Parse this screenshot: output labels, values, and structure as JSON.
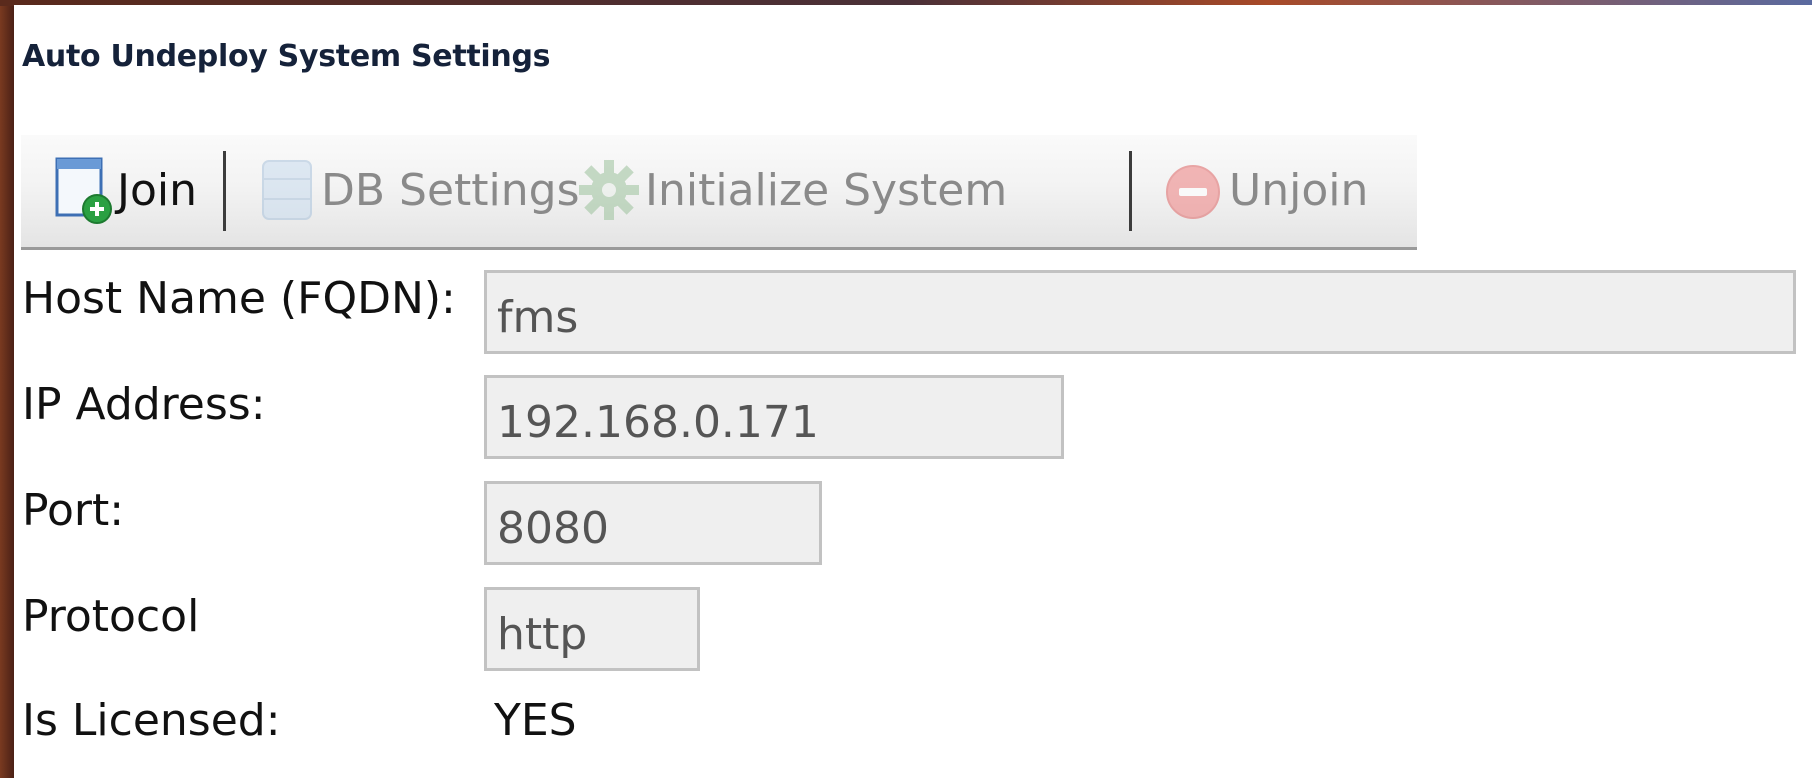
{
  "window": {
    "title": "Auto Undeploy System Settings"
  },
  "toolbar": {
    "join_label": "Join",
    "db_settings_label": "DB Settings",
    "initialize_label": "Initialize System",
    "unjoin_label": "Unjoin"
  },
  "icons": {
    "join": "document-add-icon",
    "db_settings": "database-icon",
    "initialize": "gear-icon",
    "unjoin": "remove-circle-icon"
  },
  "form": {
    "host_name": {
      "label": "Host Name (FQDN):",
      "value": "fms"
    },
    "ip_address": {
      "label": "IP Address:",
      "value": "192.168.0.171"
    },
    "port": {
      "label": "Port:",
      "value": "8080"
    },
    "protocol": {
      "label": "Protocol",
      "value": "http"
    },
    "is_licensed": {
      "label": "Is Licensed:",
      "value": "YES"
    }
  },
  "colors": {
    "title_text": "#15223a",
    "toolbar_bg": "#f0f0f0",
    "field_bg": "#efefef",
    "field_border": "#c2c2c2",
    "disabled_text": "#8a8a8a",
    "join_badge": "#2aa042",
    "unjoin_badge": "#e86a6a"
  }
}
